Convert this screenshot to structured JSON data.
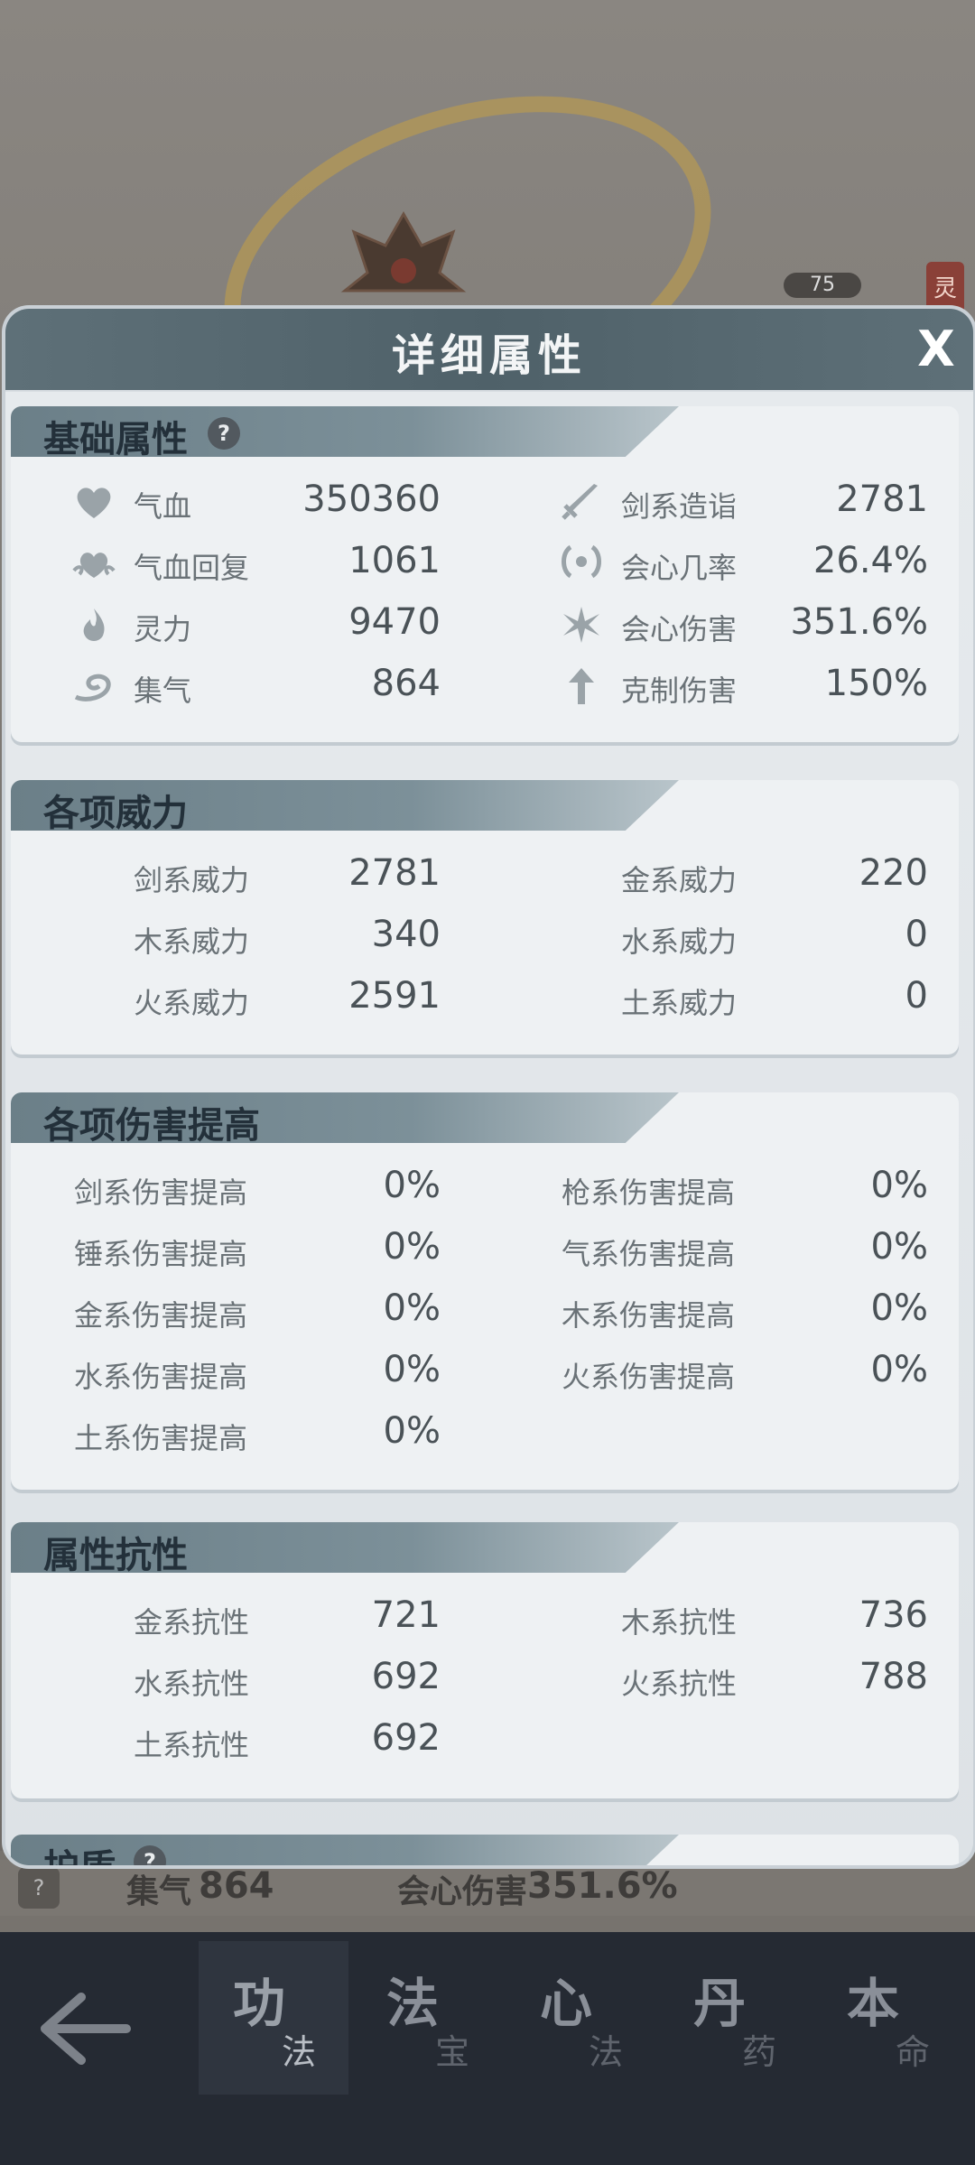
{
  "background": {
    "level": "75",
    "side_tag": "灵",
    "strip": {
      "help": "?",
      "item1_label": "集气",
      "item1_value": "864",
      "item2_label": "会心伤害",
      "item2_value": "351.6%"
    }
  },
  "modal": {
    "title": "详细属性",
    "close": "X",
    "sections": {
      "basic": {
        "title": "基础属性",
        "help": "?",
        "left": [
          {
            "icon": "heart-icon",
            "label": "气血",
            "value": "350360"
          },
          {
            "icon": "heart-regen-icon",
            "label": "气血回复",
            "value": "1061"
          },
          {
            "icon": "flame-icon",
            "label": "灵力",
            "value": "9470"
          },
          {
            "icon": "swirl-icon",
            "label": "集气",
            "value": "864"
          }
        ],
        "right": [
          {
            "icon": "sword-icon",
            "label": "剑系造诣",
            "value": "2781"
          },
          {
            "icon": "crit-chance-icon",
            "label": "会心几率",
            "value": "26.4%"
          },
          {
            "icon": "crit-damage-icon",
            "label": "会心伤害",
            "value": "351.6%"
          },
          {
            "icon": "counter-icon",
            "label": "克制伤害",
            "value": "150%"
          }
        ]
      },
      "power": {
        "title": "各项威力",
        "left": [
          {
            "label": "剑系威力",
            "value": "2781"
          },
          {
            "label": "木系威力",
            "value": "340"
          },
          {
            "label": "火系威力",
            "value": "2591"
          }
        ],
        "right": [
          {
            "label": "金系威力",
            "value": "220"
          },
          {
            "label": "水系威力",
            "value": "0"
          },
          {
            "label": "土系威力",
            "value": "0"
          }
        ]
      },
      "damage_boost": {
        "title": "各项伤害提高",
        "left": [
          {
            "label": "剑系伤害提高",
            "value": "0%"
          },
          {
            "label": "锤系伤害提高",
            "value": "0%"
          },
          {
            "label": "金系伤害提高",
            "value": "0%"
          },
          {
            "label": "水系伤害提高",
            "value": "0%"
          },
          {
            "label": "土系伤害提高",
            "value": "0%"
          }
        ],
        "right": [
          {
            "label": "枪系伤害提高",
            "value": "0%"
          },
          {
            "label": "气系伤害提高",
            "value": "0%"
          },
          {
            "label": "木系伤害提高",
            "value": "0%"
          },
          {
            "label": "火系伤害提高",
            "value": "0%"
          }
        ]
      },
      "resistance": {
        "title": "属性抗性",
        "left": [
          {
            "label": "金系抗性",
            "value": "721"
          },
          {
            "label": "水系抗性",
            "value": "692"
          },
          {
            "label": "土系抗性",
            "value": "692"
          }
        ],
        "right": [
          {
            "label": "木系抗性",
            "value": "736"
          },
          {
            "label": "火系抗性",
            "value": "788"
          }
        ]
      },
      "protection": {
        "title": "护盾",
        "help": "?"
      }
    }
  },
  "nav": {
    "tabs": [
      {
        "big": "功",
        "small": "法"
      },
      {
        "big": "法",
        "small": "宝"
      },
      {
        "big": "心",
        "small": "法"
      },
      {
        "big": "丹",
        "small": "药"
      },
      {
        "big": "本",
        "small": "命"
      }
    ]
  }
}
